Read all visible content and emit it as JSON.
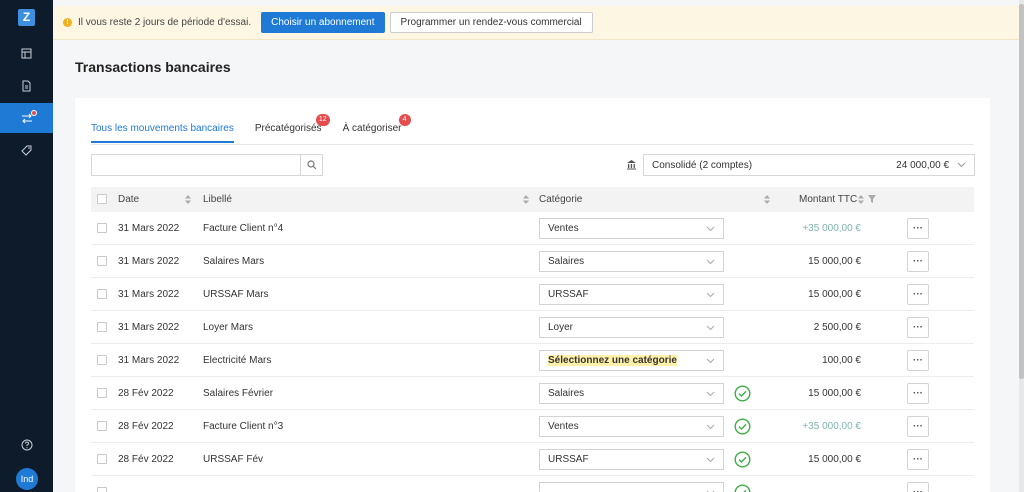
{
  "app": {
    "logo_letter": "Z",
    "avatar_initials": "Ind"
  },
  "banner": {
    "text": "Il vous reste 2 jours de période d'essai.",
    "primary_button": "Choisir un abonnement",
    "secondary_button": "Programmer un rendez-vous commercial"
  },
  "page": {
    "title": "Transactions bancaires"
  },
  "tabs": [
    {
      "label": "Tous les mouvements bancaires",
      "badge": ""
    },
    {
      "label": "Précatégorisés",
      "badge": "12"
    },
    {
      "label": "À catégoriser",
      "badge": "4"
    }
  ],
  "search": {
    "placeholder": "",
    "value": ""
  },
  "account": {
    "name": "Consolidé (2 comptes)",
    "amount": "24 000,00 €"
  },
  "table": {
    "headers": {
      "date": "Date",
      "label": "Libellé",
      "category": "Catégorie",
      "amount": "Montant TTC"
    },
    "rows": [
      {
        "date": "31 Mars 2022",
        "label": "Facture Client n°4",
        "category": "Ventes",
        "amount": "+35 000,00 €",
        "positive": true,
        "checked": false,
        "highlight": false
      },
      {
        "date": "31 Mars 2022",
        "label": "Salaires Mars",
        "category": "Salaires",
        "amount": "15 000,00 €",
        "positive": false,
        "checked": false,
        "highlight": false
      },
      {
        "date": "31 Mars 2022",
        "label": "URSSAF Mars",
        "category": "URSSAF",
        "amount": "15 000,00 €",
        "positive": false,
        "checked": false,
        "highlight": false
      },
      {
        "date": "31 Mars 2022",
        "label": "Loyer Mars",
        "category": "Loyer",
        "amount": "2 500,00 €",
        "positive": false,
        "checked": false,
        "highlight": false
      },
      {
        "date": "31 Mars 2022",
        "label": "Electricité Mars",
        "category": "Sélectionnez une catégorie",
        "amount": "100,00 €",
        "positive": false,
        "checked": false,
        "highlight": true
      },
      {
        "date": "28 Fév 2022",
        "label": "Salaires Février",
        "category": "Salaires",
        "amount": "15 000,00 €",
        "positive": false,
        "checked": true,
        "highlight": false
      },
      {
        "date": "28 Fév 2022",
        "label": "Facture Client n°3",
        "category": "Ventes",
        "amount": "+35 000,00 €",
        "positive": true,
        "checked": true,
        "highlight": false
      },
      {
        "date": "28 Fév 2022",
        "label": "URSSAF Fév",
        "category": "URSSAF",
        "amount": "15 000,00 €",
        "positive": false,
        "checked": true,
        "highlight": false
      },
      {
        "date": "",
        "label": "",
        "category": "",
        "amount": "",
        "positive": false,
        "checked": true,
        "highlight": false
      }
    ],
    "more_label": "···"
  },
  "colors": {
    "primary": "#1f7ad6",
    "sidebar": "#0d1b2a",
    "positive_amount": "#7fb4ae",
    "success": "#3cb043",
    "badge": "#e74c4c",
    "banner_bg": "#fdf6e3"
  },
  "icons": {
    "sidebar": [
      "dashboard-icon",
      "document-icon",
      "transfer-icon",
      "tag-icon",
      "help-icon"
    ],
    "search": "search-icon",
    "bank": "bank-icon",
    "row_check": "check-circle-icon"
  }
}
